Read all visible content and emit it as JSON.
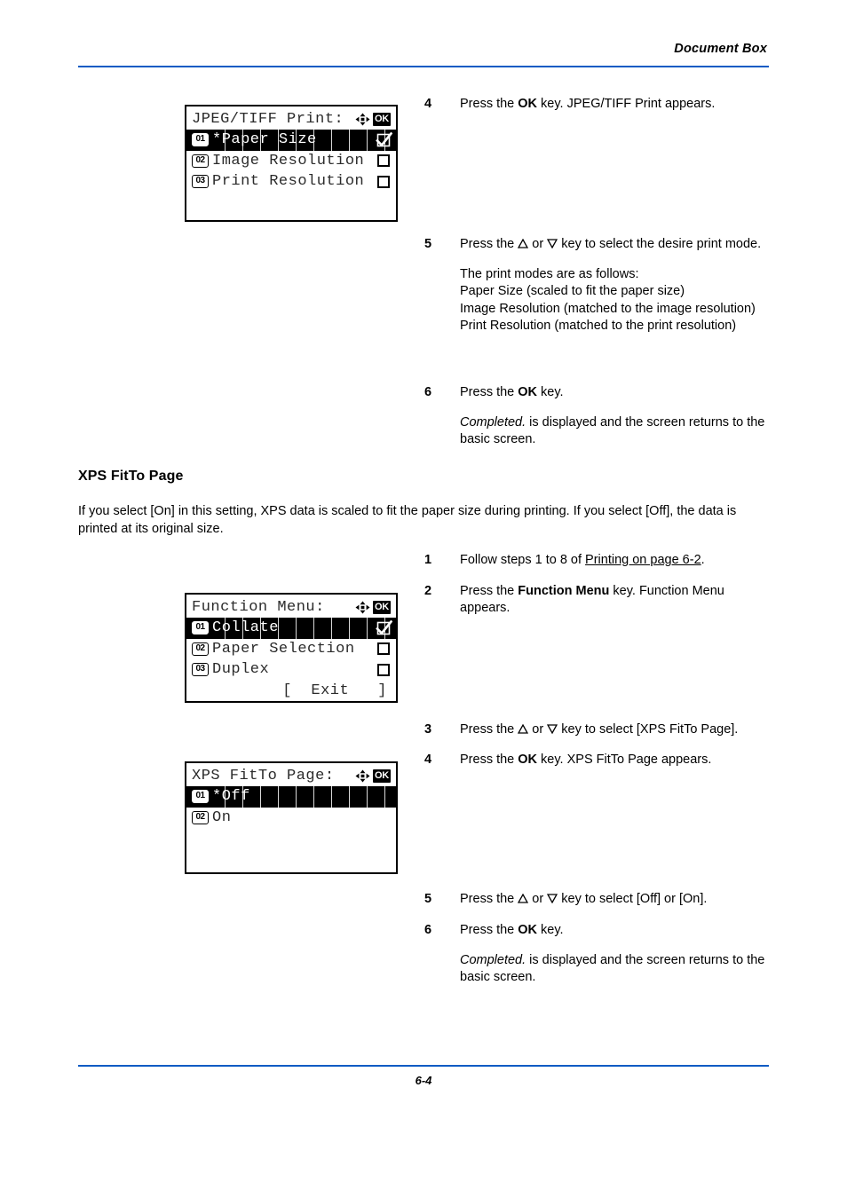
{
  "header": {
    "title": "Document Box",
    "rule_color": "#0a5bc4"
  },
  "footer": {
    "page_number": "6-4",
    "rule_color": "#0a5bc4"
  },
  "section": {
    "heading": "XPS FitTo Page",
    "paragraph": "If you select [On] in this setting, XPS data is scaled to fit the paper size during printing. If you select [Off], the data is printed at its original size."
  },
  "panels": {
    "jpeg_tiff_print": {
      "title": "JPEG/TIFF Print:",
      "nav_icon": "four-way-arrow-icon",
      "ok_icon_label": "OK",
      "rows": [
        {
          "badge": "01",
          "label": "*Paper Size",
          "mark": "check",
          "selected": true
        },
        {
          "badge": "02",
          "label": "Image Resolution",
          "mark": "box",
          "selected": false
        },
        {
          "badge": "03",
          "label": "Print Resolution",
          "mark": "box",
          "selected": false
        }
      ]
    },
    "function_menu": {
      "title": "Function Menu:",
      "nav_icon": "four-way-arrow-icon",
      "ok_icon_label": "OK",
      "rows": [
        {
          "badge": "01",
          "label": "Collate",
          "mark": "check",
          "selected": true
        },
        {
          "badge": "02",
          "label": "Paper Selection",
          "mark": "box",
          "selected": false
        },
        {
          "badge": "03",
          "label": "Duplex",
          "mark": "box",
          "selected": false
        }
      ],
      "exit_label": "[  Exit   ]"
    },
    "xps_fitto_page": {
      "title": "XPS FitTo Page:",
      "nav_icon": "four-way-arrow-icon",
      "ok_icon_label": "OK",
      "rows": [
        {
          "badge": "01",
          "label": "*Off",
          "mark": "none",
          "selected": true
        },
        {
          "badge": "02",
          "label": "On",
          "mark": "none",
          "selected": false
        }
      ]
    }
  },
  "steps_jpeg": {
    "s4": {
      "num": "4",
      "text_pre": "Press the ",
      "bold": "OK",
      "text_post": " key. JPEG/TIFF Print appears."
    },
    "s5": {
      "num": "5",
      "line1_pre": "Press the ",
      "line1_mid": " or ",
      "line1_post": " key to select the desire print mode.",
      "modes_intro": "The print modes are as follows:",
      "mode1": "Paper Size (scaled to fit the paper size)",
      "mode2": "Image Resolution (matched to the image resolution)",
      "mode3": "Print Resolution (matched to the print resolution)"
    },
    "s6": {
      "num": "6",
      "text_pre": "Press the ",
      "bold": "OK",
      "text_post": " key.",
      "completed_italic": "Completed.",
      "completed_rest": " is displayed and the screen returns to the basic screen."
    }
  },
  "steps_xps": {
    "s1": {
      "num": "1",
      "text_pre": "Follow steps 1 to 8 of ",
      "link": "Printing on page 6-2",
      "text_post": "."
    },
    "s2": {
      "num": "2",
      "text_pre": "Press the ",
      "bold": "Function Menu",
      "text_post": " key. Function Menu appears."
    },
    "s3": {
      "num": "3",
      "text_pre": "Press the ",
      "text_mid": " or ",
      "text_post": " key to select [XPS FitTo Page]."
    },
    "s4": {
      "num": "4",
      "text_pre": "Press the ",
      "bold": "OK",
      "text_post": " key. XPS FitTo Page appears."
    },
    "s5": {
      "num": "5",
      "text_pre": "Press the ",
      "text_mid": " or ",
      "text_post": " key to select [Off] or [On]."
    },
    "s6": {
      "num": "6",
      "text_pre": "Press the ",
      "bold": "OK",
      "text_post": " key.",
      "completed_italic": "Completed.",
      "completed_rest": " is displayed and the screen returns to the basic screen."
    }
  }
}
